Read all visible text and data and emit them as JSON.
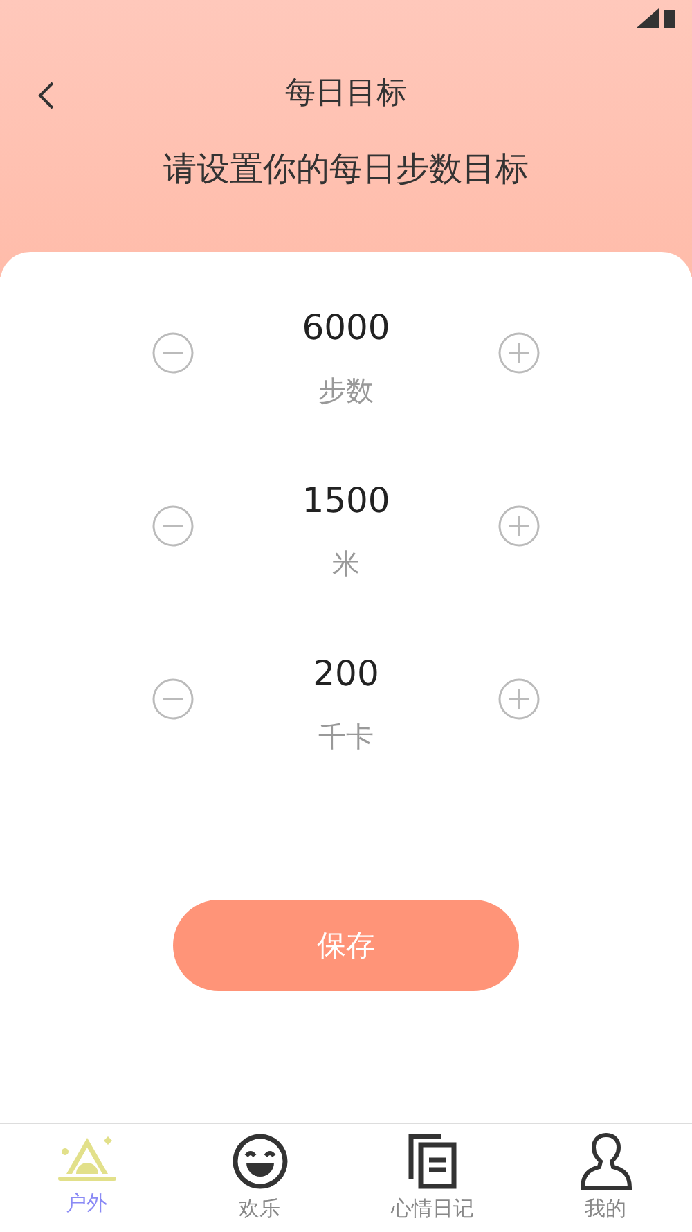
{
  "header": {
    "title": "每日目标",
    "subtitle": "请设置你的每日步数目标"
  },
  "goals": [
    {
      "value": "6000",
      "unit": "步数"
    },
    {
      "value": "1500",
      "unit": "米"
    },
    {
      "value": "200",
      "unit": "千卡"
    }
  ],
  "save_button": "保存",
  "tab_bar": [
    {
      "label": "户外",
      "kind": "outdoor",
      "selected": true
    },
    {
      "label": "欢乐",
      "kind": "smile",
      "selected": false
    },
    {
      "label": "心情日记",
      "kind": "diary",
      "selected": false
    },
    {
      "label": "我的",
      "kind": "profile",
      "selected": false
    }
  ]
}
